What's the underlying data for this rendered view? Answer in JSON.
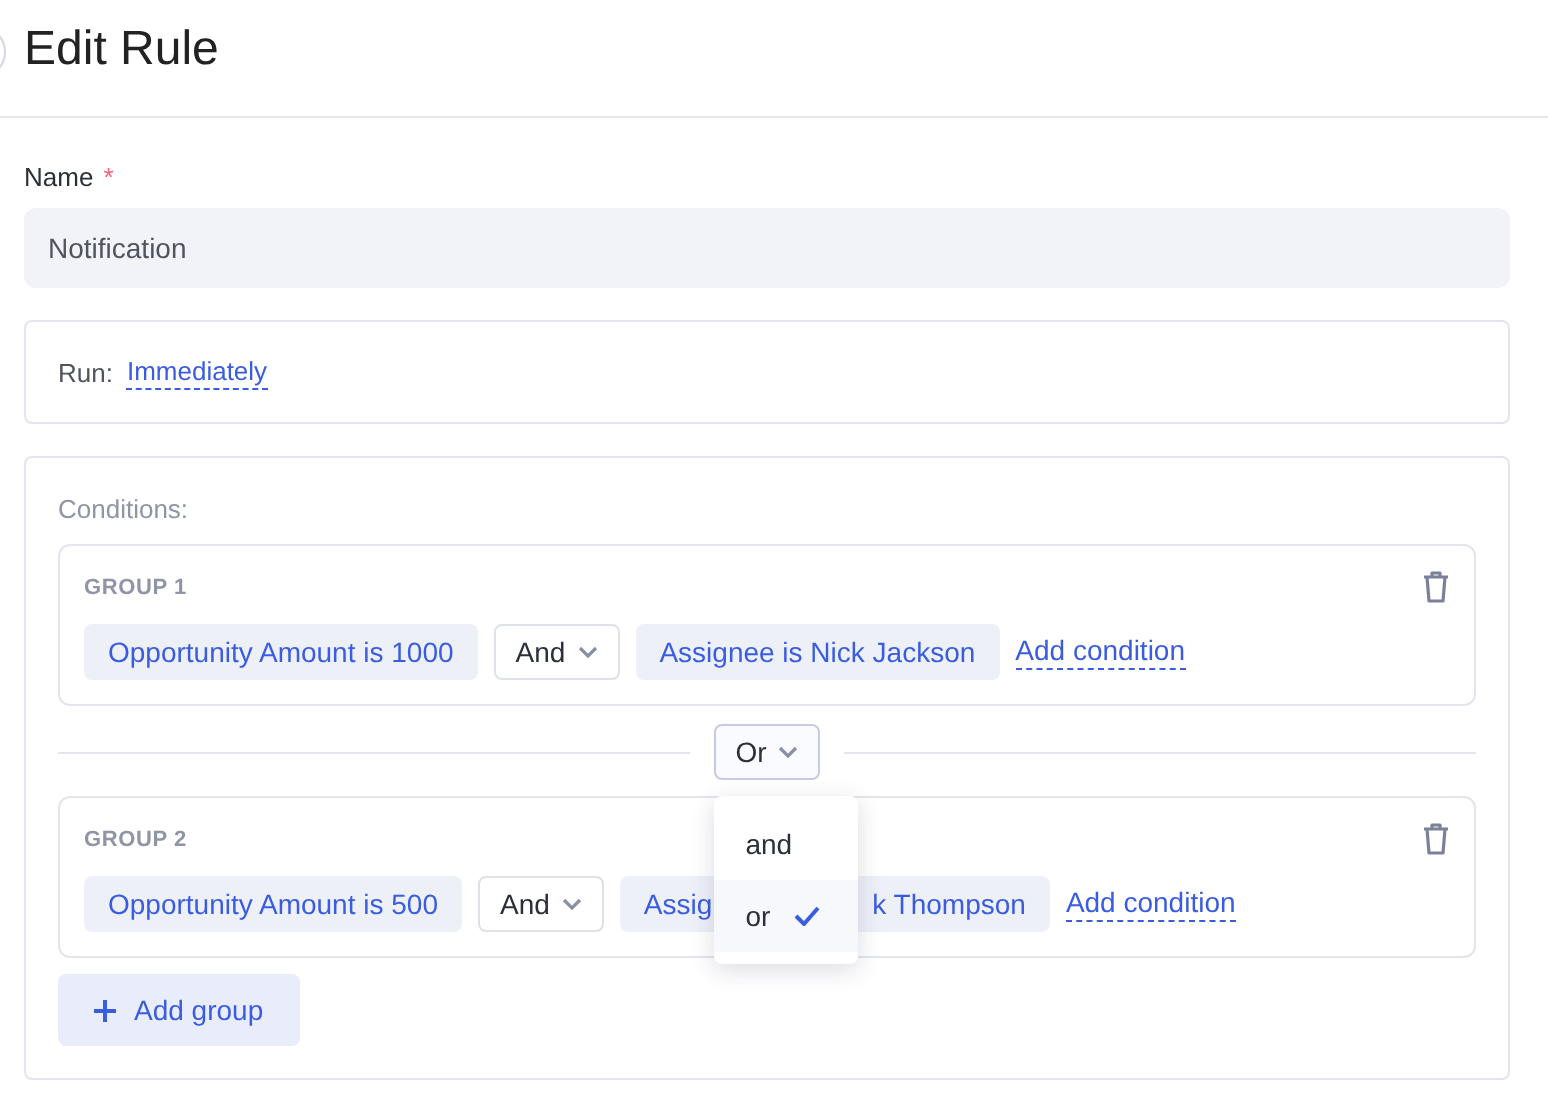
{
  "header": {
    "title": "Edit Rule"
  },
  "name_field": {
    "label": "Name",
    "required_mark": "*",
    "value": "Notification"
  },
  "run": {
    "label": "Run:",
    "value": "Immediately"
  },
  "conditions": {
    "label": "Conditions:",
    "groups": [
      {
        "title": "GROUP 1",
        "items": [
          {
            "kind": "condition",
            "text": "Opportunity Amount is 1000"
          },
          {
            "kind": "operator",
            "text": "And"
          },
          {
            "kind": "condition",
            "text": "Assignee is Nick Jackson"
          },
          {
            "kind": "add",
            "text": "Add condition"
          }
        ]
      },
      {
        "title": "GROUP 2",
        "items": [
          {
            "kind": "condition",
            "text": "Opportunity Amount is 500"
          },
          {
            "kind": "operator",
            "text": "And"
          },
          {
            "kind": "covered",
            "text_start": "Assig",
            "text_end": "k Thompson"
          },
          {
            "kind": "add",
            "text": "Add condition"
          }
        ]
      }
    ],
    "group_join": {
      "value": "Or",
      "expanded": true,
      "options": [
        {
          "label": "and",
          "selected": false
        },
        {
          "label": "or",
          "selected": true
        }
      ]
    },
    "add_group": "Add group"
  }
}
